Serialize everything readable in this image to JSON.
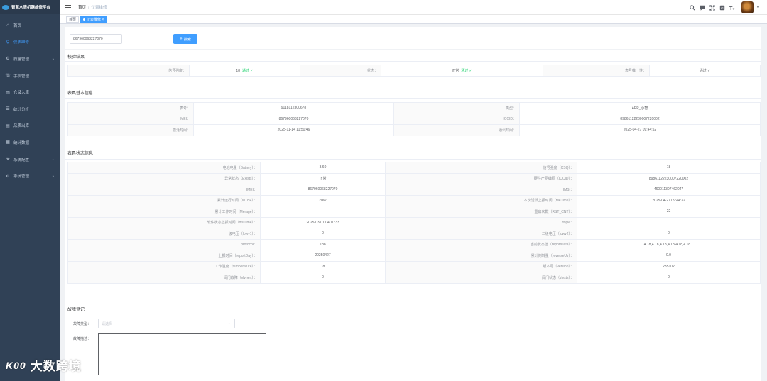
{
  "app": {
    "title": "智慧水表机器维修平台"
  },
  "sidebar": {
    "items": [
      {
        "label": "首页",
        "icon": "home-icon",
        "active": false,
        "has_children": false
      },
      {
        "label": "仪表维修",
        "icon": "search-icon",
        "active": true,
        "has_children": false
      },
      {
        "label": "质量管理",
        "icon": "settings-icon",
        "active": false,
        "has_children": true
      },
      {
        "label": "手机管理",
        "icon": "phone-icon",
        "active": false,
        "has_children": false
      },
      {
        "label": "仓储入库",
        "icon": "chart-icon",
        "active": false,
        "has_children": false
      },
      {
        "label": "统计分析",
        "icon": "list-icon",
        "active": false,
        "has_children": false
      },
      {
        "label": "品质出库",
        "icon": "document-icon",
        "active": false,
        "has_children": false
      },
      {
        "label": "统计数据",
        "icon": "report-icon",
        "active": false,
        "has_children": false
      },
      {
        "label": "系统配置",
        "icon": "config-icon",
        "active": false,
        "has_children": true
      },
      {
        "label": "系统管理",
        "icon": "gear-icon",
        "active": false,
        "has_children": true
      }
    ]
  },
  "navbar": {
    "breadcrumb": [
      "首页",
      "仪表维修"
    ],
    "icons": [
      "search-icon",
      "message-icon",
      "fullscreen-icon",
      "docs-icon",
      "font-size-icon"
    ]
  },
  "tags": [
    {
      "label": "首页",
      "active": false
    },
    {
      "label": "仪表维修",
      "active": true
    }
  ],
  "search": {
    "value": "867960068227070",
    "button_label": "搜索"
  },
  "check_result": {
    "title": "校验结果",
    "rows": [
      {
        "label1": "信号强度：",
        "value1": "18",
        "status1": "通过 ✓",
        "label2": "状态：",
        "value2": "正常",
        "status2": "通过 ✓",
        "label3": "表号唯一性：",
        "status3": "通过 ✓"
      }
    ]
  },
  "basic_info": {
    "title": "表具基本信息",
    "rows": [
      {
        "label1": "表号：",
        "value1": "9118112300678",
        "label2": "类型：",
        "value2": "AEP_小智"
      },
      {
        "label1": "IMEI：",
        "value1": "867960068227070",
        "label2": "ICCID：",
        "value2": "89861122230007220002"
      },
      {
        "label1": "激活时间：",
        "value1": "2025-11-14 11:50:46",
        "label2": "通讯时间：",
        "value2": "2025-04-27 09:44:52"
      }
    ]
  },
  "status_info": {
    "title": "表具状态信息",
    "rows": [
      {
        "label1": "电池电量（Battery）：",
        "value1": "3.60",
        "label2": "信号强度（CSQ）：",
        "value2": "18"
      },
      {
        "label1": "异常状态（Exists）：",
        "value1": "正常",
        "label2": "硬件产品编码（ICCID）：",
        "value2": "89861122230007220002"
      },
      {
        "label1": "IMEI：",
        "value1": "867960068227070",
        "label2": "IMSI：",
        "value2": "460011307462047"
      },
      {
        "label1": "累计运行时间（MTBF）：",
        "value1": "2067",
        "label2": "本次活跃上报时间（MeTime）：",
        "value2": "2025-04-27 09:44:32"
      },
      {
        "label1": "累计工作时间（Merage）：",
        "value1": "",
        "label2": "重启次数（RST_CNT）：",
        "value2": "22"
      },
      {
        "label1": "软件状态上报时间（dtuTime）：",
        "value1": "2025-03-01 04:10:33",
        "label2": "dtype：",
        "value2": ""
      },
      {
        "label1": "一级电压（lowv1）：",
        "value1": "0",
        "label2": "二级电压（lowv2）：",
        "value2": "0"
      },
      {
        "label1": "protocol：",
        "value1": "188",
        "label2": "当前状态值（reportData）：",
        "value2": "4.18,4.18,4.18,4.18,4.18,4.18..."
      },
      {
        "label1": "上报时间（reportDay）：",
        "value1": "20250427",
        "label2": "累计倒转量（reverseUv）：",
        "value2": "0.0"
      },
      {
        "label1": "工作温度（temperature）：",
        "value1": "18",
        "label2": "版本号（version）：",
        "value2": "235102"
      },
      {
        "label1": "阀门故障（vlvhert）：",
        "value1": "0",
        "label2": "阀门状态（vlvsts）：",
        "value2": "0"
      }
    ]
  },
  "fault": {
    "title": "故障登记",
    "type_label": "故障类型：",
    "type_placeholder": "请选择",
    "desc_label": "故障描述："
  },
  "watermark": {
    "logo": "K00",
    "text": "大数跨境"
  }
}
